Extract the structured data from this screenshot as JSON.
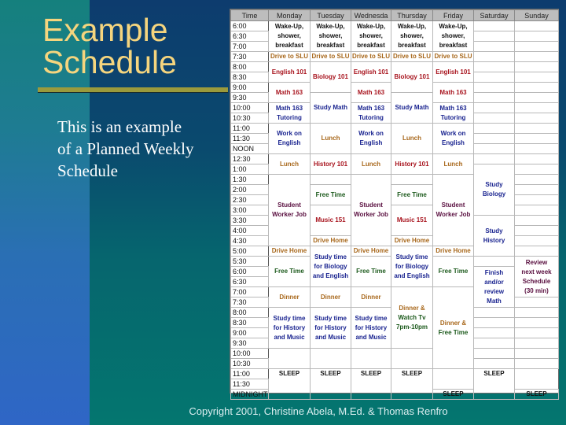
{
  "slide": {
    "title_line1": "Example",
    "title_line2": "Schedule",
    "subtitle": "This is an example of a Planned Weekly Schedule",
    "copyright": "Copyright 2001, Christine Abela, M.Ed. & Thomas Renfro"
  },
  "schedule": {
    "headers": [
      "Time",
      "Monday",
      "Tuesday",
      "Wednesda",
      "Thursday",
      "Friday",
      "Saturday",
      "Sunday"
    ],
    "times": [
      "6:00",
      "6:30",
      "7:00",
      "7:30",
      "8:00",
      "8:30",
      "9:00",
      "9:30",
      "10:00",
      "10:30",
      "11:00",
      "11:30",
      "NOON",
      "12:30",
      "1:00",
      "1:30",
      "2:00",
      "2:30",
      "3:00",
      "3:30",
      "4:00",
      "4:30",
      "5:00",
      "5:30",
      "6:00",
      "6:30",
      "7:00",
      "7:30",
      "8:00",
      "8:30",
      "9:00",
      "9:30",
      "10:00",
      "10:30",
      "11:00",
      "11:30",
      "MIDNIGHT"
    ],
    "events": {
      "wake": [
        "Wake-Up,",
        "shower,",
        "breakfast"
      ],
      "drive_slu": "Drive to SLU",
      "english101": "English 101",
      "biology101": "Biology 101",
      "math163": "Math 163",
      "math_tutoring": [
        "Math 163",
        "Tutoring"
      ],
      "study_math": "Study Math",
      "work_english": [
        "Work on",
        "English"
      ],
      "lunch": "Lunch",
      "history101": "History 101",
      "free_time": "Free Time",
      "student_job": [
        "Student",
        "Worker Job"
      ],
      "music151": "Music 151",
      "drive_home": "Drive Home",
      "study_bio_eng": [
        "Study time",
        "for Biology",
        "and English"
      ],
      "dinner": "Dinner",
      "dinner_tv": [
        "Dinner &",
        "Watch Tv",
        "7pm-10pm"
      ],
      "dinner_free": [
        "Dinner &",
        "Free Time"
      ],
      "study_hist_music": [
        "Study time",
        "for History",
        "and Music"
      ],
      "sleep": "SLEEP",
      "study_biology": [
        "Study",
        "Biology"
      ],
      "study_history": [
        "Study",
        "History"
      ],
      "finish_math": [
        "Finish",
        "and/or",
        "review",
        "Math"
      ],
      "review_week": [
        "Review",
        "next week",
        "Schedule",
        "(30 min)"
      ]
    },
    "colors": {
      "routine": "#111111",
      "travel_meal": "#a8681c",
      "class": "#a8141e",
      "study": "#1a2490",
      "free": "#1c5a1c",
      "work": "#5a1040"
    }
  }
}
